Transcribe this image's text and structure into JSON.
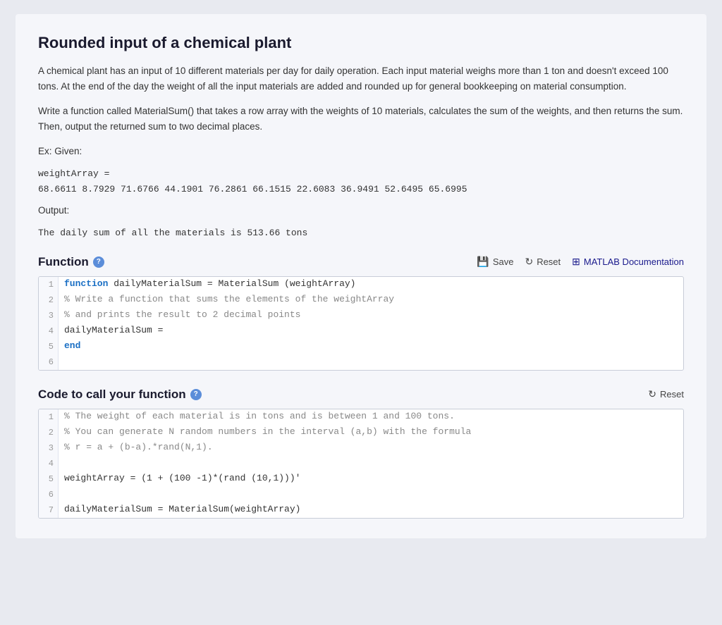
{
  "page": {
    "title": "Rounded input of a chemical plant",
    "description1": "A chemical plant has an input of 10 different materials per day for daily operation. Each input material weighs more than 1 ton and doesn't exceed 100 tons. At the end of the day the weight of all the input materials are added and rounded up for general bookkeeping on material consumption.",
    "description2": "Write a function called MaterialSum() that takes a row array with the weights of 10 materials, calculates the sum of the weights, and then returns the sum. Then, output the returned sum to two decimal places.",
    "example_label": "Ex: Given:",
    "weight_array_label": "weightArray =",
    "weight_values": "    68.6611    8.7929    71.6766    44.1901    76.2861    66.1515    22.6083    36.9491    52.6495    65.6995",
    "output_label": "Output:",
    "output_value": "The daily sum of all the materials is 513.66 tons"
  },
  "function_section": {
    "title": "Function",
    "save_label": "Save",
    "reset_label": "Reset",
    "matlab_label": "MATLAB Documentation",
    "code_lines": [
      {
        "num": "1",
        "code": "function dailyMaterialSum = MaterialSum (weightArray)",
        "type": "function"
      },
      {
        "num": "2",
        "code": "% Write a function that sums the elements of the weightArray",
        "type": "comment"
      },
      {
        "num": "3",
        "code": "% and prints the result to 2 decimal points",
        "type": "comment"
      },
      {
        "num": "4",
        "code": "dailyMaterialSum =",
        "type": "normal"
      },
      {
        "num": "5",
        "code": "end",
        "type": "end"
      },
      {
        "num": "6",
        "code": "",
        "type": "normal"
      }
    ]
  },
  "call_section": {
    "title": "Code to call your function",
    "reset_label": "Reset",
    "code_lines": [
      {
        "num": "1",
        "code": "% The weight of each material is in tons and is between 1 and 100 tons.",
        "type": "comment"
      },
      {
        "num": "2",
        "code": "% You can generate N random numbers in the interval (a,b) with the formula",
        "type": "comment"
      },
      {
        "num": "3",
        "code": "% r = a + (b-a).*rand(N,1).",
        "type": "comment"
      },
      {
        "num": "4",
        "code": "",
        "type": "normal"
      },
      {
        "num": "5",
        "code": "weightArray = (1 + (100 -1)*(rand (10,1)))'",
        "type": "normal"
      },
      {
        "num": "6",
        "code": "",
        "type": "normal"
      },
      {
        "num": "7",
        "code": "dailyMaterialSum = MaterialSum(weightArray)",
        "type": "normal"
      }
    ]
  },
  "icons": {
    "save": "💾",
    "reset": "↻",
    "matlab": "⊞",
    "help": "?"
  }
}
